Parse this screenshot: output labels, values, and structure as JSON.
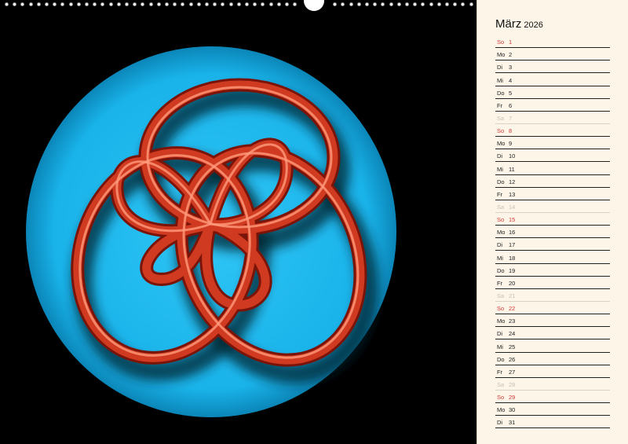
{
  "calendar": {
    "month": "März",
    "year": "2026",
    "days": [
      {
        "wd": "So",
        "d": "1",
        "type": "sun"
      },
      {
        "wd": "Mo",
        "d": "2",
        "type": "work"
      },
      {
        "wd": "Di",
        "d": "3",
        "type": "work"
      },
      {
        "wd": "Mi",
        "d": "4",
        "type": "work"
      },
      {
        "wd": "Do",
        "d": "5",
        "type": "work"
      },
      {
        "wd": "Fr",
        "d": "6",
        "type": "work"
      },
      {
        "wd": "Sa",
        "d": "7",
        "type": "sat"
      },
      {
        "wd": "So",
        "d": "8",
        "type": "sun"
      },
      {
        "wd": "Mo",
        "d": "9",
        "type": "work"
      },
      {
        "wd": "Di",
        "d": "10",
        "type": "work"
      },
      {
        "wd": "Mi",
        "d": "11",
        "type": "work"
      },
      {
        "wd": "Do",
        "d": "12",
        "type": "work"
      },
      {
        "wd": "Fr",
        "d": "13",
        "type": "work"
      },
      {
        "wd": "Sa",
        "d": "14",
        "type": "sat"
      },
      {
        "wd": "So",
        "d": "15",
        "type": "sun"
      },
      {
        "wd": "Mo",
        "d": "16",
        "type": "work"
      },
      {
        "wd": "Di",
        "d": "17",
        "type": "work"
      },
      {
        "wd": "Mi",
        "d": "18",
        "type": "work"
      },
      {
        "wd": "Do",
        "d": "19",
        "type": "work"
      },
      {
        "wd": "Fr",
        "d": "20",
        "type": "work"
      },
      {
        "wd": "Sa",
        "d": "21",
        "type": "sat"
      },
      {
        "wd": "So",
        "d": "22",
        "type": "sun"
      },
      {
        "wd": "Mo",
        "d": "23",
        "type": "work"
      },
      {
        "wd": "Di",
        "d": "24",
        "type": "work"
      },
      {
        "wd": "Mi",
        "d": "25",
        "type": "work"
      },
      {
        "wd": "Do",
        "d": "26",
        "type": "work"
      },
      {
        "wd": "Fr",
        "d": "27",
        "type": "work"
      },
      {
        "wd": "Sa",
        "d": "28",
        "type": "sat"
      },
      {
        "wd": "So",
        "d": "29",
        "type": "sun"
      },
      {
        "wd": "Mo",
        "d": "30",
        "type": "work"
      },
      {
        "wd": "Di",
        "d": "31",
        "type": "work"
      }
    ]
  },
  "artwork": {
    "subject": "fractal-knot-icon",
    "colors": {
      "background": "#000000",
      "disc": "#1ab4e8",
      "tube": "#c8321c",
      "tube_highlight": "#ff8a6a"
    }
  }
}
